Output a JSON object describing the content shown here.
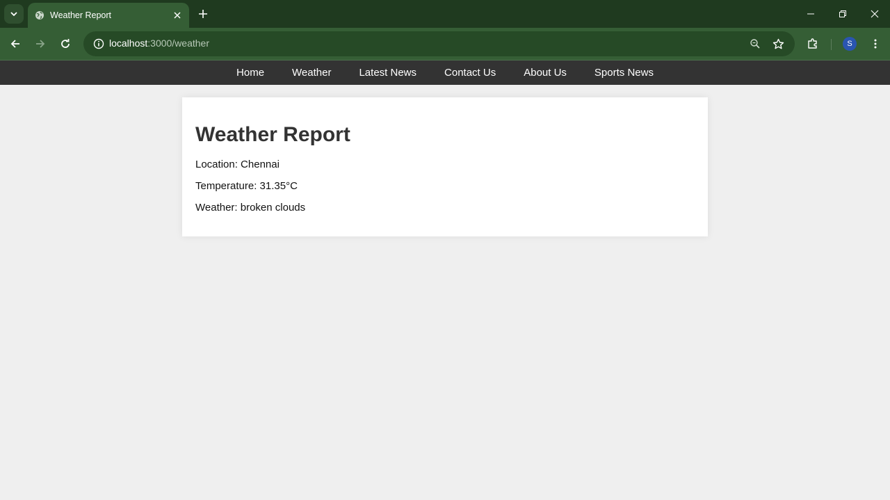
{
  "browser": {
    "tab_title": "Weather Report",
    "url_host": "localhost",
    "url_path": ":3000/weather",
    "profile_initial": "S"
  },
  "nav": {
    "items": [
      "Home",
      "Weather",
      "Latest News",
      "Contact Us",
      "About Us",
      "Sports News"
    ]
  },
  "report": {
    "title": "Weather Report",
    "location": "Location: Chennai",
    "temperature": "Temperature: 31.35°C",
    "weather": "Weather: broken clouds"
  }
}
